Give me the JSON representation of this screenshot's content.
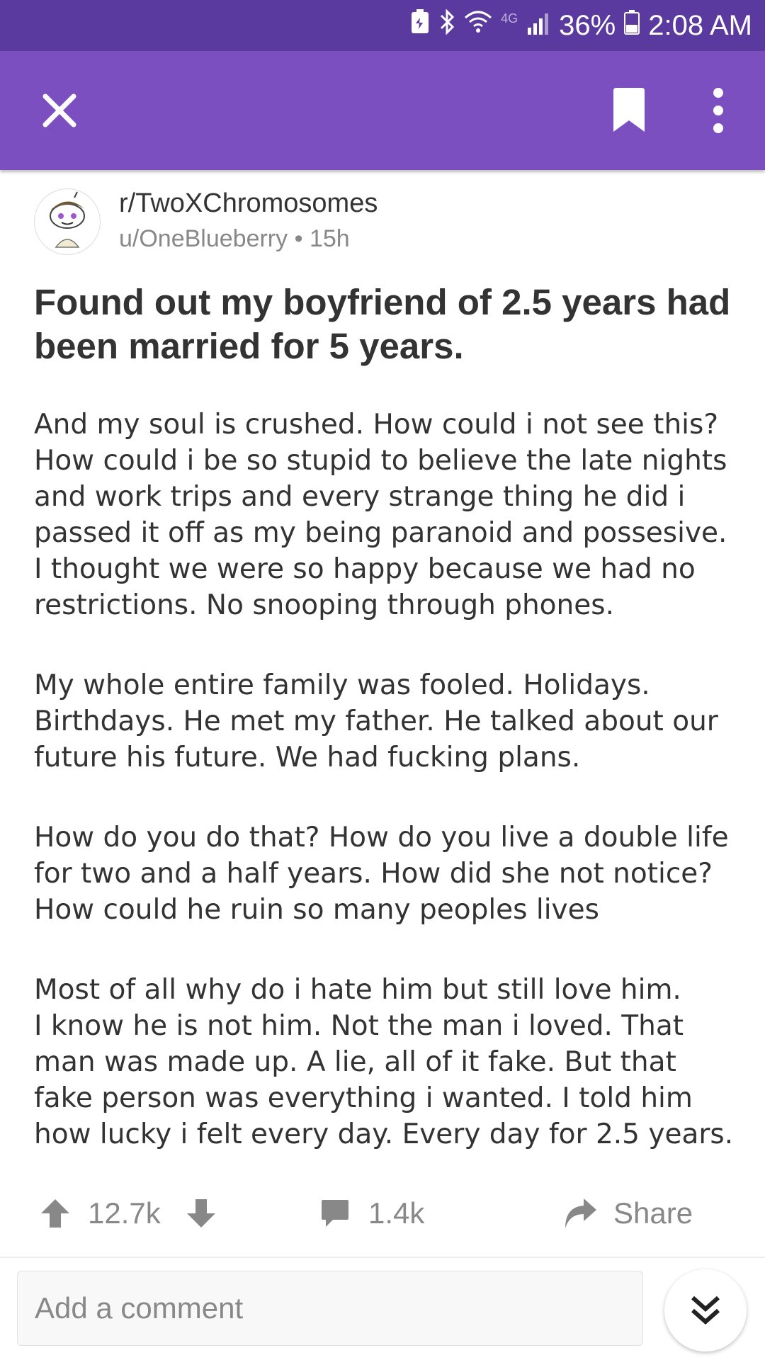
{
  "status_bar": {
    "network": "4G",
    "battery": "36%",
    "time": "2:08 AM"
  },
  "post": {
    "subreddit": "r/TwoXChromosomes",
    "author": "u/OneBlueberry",
    "separator": "•",
    "age": "15h",
    "title": "Found out my boyfriend of 2.5 years had been married for 5 years.",
    "paragraphs": [
      "And my soul is crushed. How could i not see this? How could i be so stupid to believe the late nights and work trips and every strange thing he did i passed it off as my being paranoid and possesive. I thought we were so happy because we had no restrictions. No snooping through phones.",
      "My whole entire family was fooled. Holidays. Birthdays. He met my father. He talked about our future his future. We had fucking plans.",
      "How do you do that? How do you live a double life for two and a half years. How did she not notice? How could he ruin so many peoples lives",
      "Most of all why do i hate him but still love him.\nI know he is not him. Not the man i loved. That man was made up. A lie, all of it fake. But that fake person was everything i wanted. I told him how lucky i felt every day. Every day for 2.5 years."
    ]
  },
  "actions": {
    "upvotes": "12.7k",
    "comments": "1.4k",
    "share_label": "Share"
  },
  "comment_box": {
    "placeholder": "Add a comment"
  },
  "icons": {
    "close": "close-icon",
    "bookmark": "bookmark-icon",
    "more": "more-vert-icon",
    "upvote": "arrow-up-icon",
    "downvote": "arrow-down-icon",
    "comment": "comment-bubble-icon",
    "share": "share-arrow-icon",
    "scroll": "double-chevron-down-icon"
  },
  "colors": {
    "status_bar": "#5a3a9e",
    "toolbar": "#7b4fc0",
    "text": "#333333",
    "muted": "#888888"
  }
}
